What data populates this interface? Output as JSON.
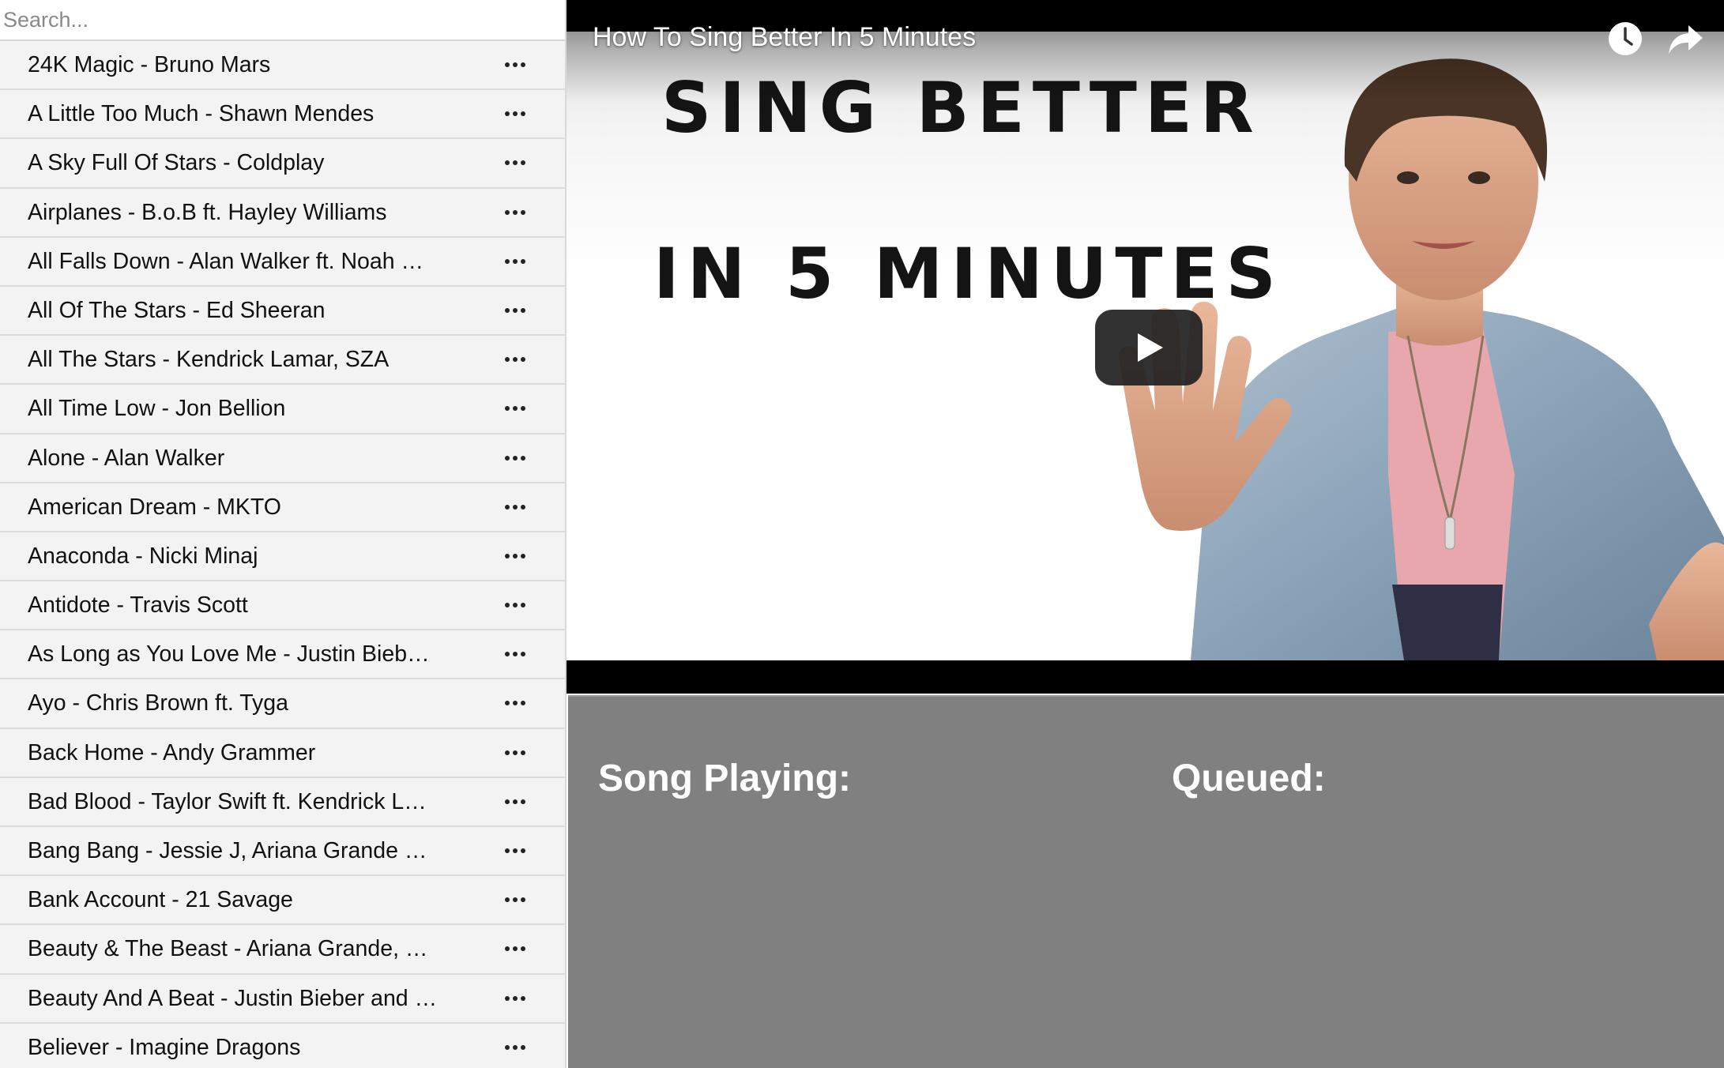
{
  "search": {
    "placeholder": "Search...",
    "value": ""
  },
  "songs": [
    {
      "title": "24K Magic - Bruno Mars"
    },
    {
      "title": "A Little Too Much - Shawn Mendes"
    },
    {
      "title": "A Sky Full Of Stars - Coldplay"
    },
    {
      "title": "Airplanes - B.o.B ft. Hayley Williams"
    },
    {
      "title": "All Falls Down - Alan Walker ft. Noah Cyrus, Digital Farm Animals"
    },
    {
      "title": "All Of The Stars - Ed Sheeran"
    },
    {
      "title": "All The Stars - Kendrick Lamar, SZA"
    },
    {
      "title": "All Time Low - Jon Bellion"
    },
    {
      "title": "Alone - Alan Walker"
    },
    {
      "title": "American Dream - MKTO"
    },
    {
      "title": "Anaconda - Nicki Minaj"
    },
    {
      "title": "Antidote - Travis Scott"
    },
    {
      "title": "As Long as You Love Me - Justin Bieber ft. Big Sean"
    },
    {
      "title": "Ayo - Chris Brown ft. Tyga"
    },
    {
      "title": "Back Home - Andy Grammer"
    },
    {
      "title": "Bad Blood - Taylor Swift ft. Kendrick Lamar"
    },
    {
      "title": "Bang Bang - Jessie J, Ariana Grande and Nicki Minaj"
    },
    {
      "title": "Bank Account - 21 Savage"
    },
    {
      "title": "Beauty & The Beast - Ariana Grande, John Legend"
    },
    {
      "title": "Beauty And A Beat - Justin Bieber and Nicki Minaj"
    },
    {
      "title": "Believer - Imagine Dragons"
    }
  ],
  "video": {
    "title": "How To Sing Better In 5 Minutes",
    "thumbnail_text_line1": "SING BETTER",
    "thumbnail_text_line2": "IN 5 MINUTES",
    "icons": {
      "watch_later": "clock-icon",
      "share": "share-arrow-icon",
      "play": "play-button-icon"
    }
  },
  "panel": {
    "song_playing_label": "Song Playing:",
    "queued_label": "Queued:"
  },
  "colors": {
    "panel_bg": "#808080",
    "list_bg": "#f3f3f3",
    "play_button": "#212121"
  }
}
